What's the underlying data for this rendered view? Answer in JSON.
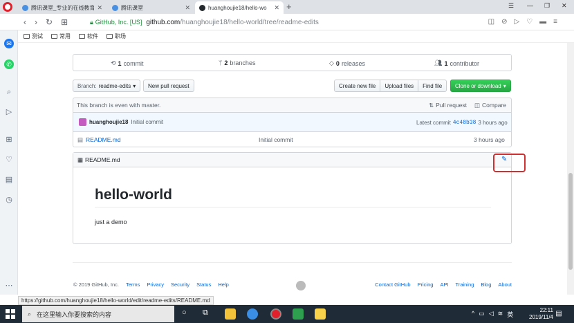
{
  "browser": {
    "tabs": [
      {
        "title": "腾讯课堂_专业的在线教育",
        "active": false
      },
      {
        "title": "腾讯课堂",
        "active": false
      },
      {
        "title": "huanghoujie18/hello-wo",
        "active": true
      }
    ],
    "new_tab": "+",
    "url_org": "GitHub, Inc. [US]",
    "url_host": "github.com",
    "url_path": "/huanghoujie18/hello-world/tree/readme-edits",
    "bookmarks": [
      "测试",
      "常用",
      "软件",
      "职场"
    ],
    "status_url": "https://github.com/huanghoujie18/hello-world/edit/readme-edits/README.md"
  },
  "repo": {
    "stats": {
      "commits": "1",
      "commits_label": "commit",
      "branches": "2",
      "branches_label": "branches",
      "releases": "0",
      "releases_label": "releases",
      "contributors": "1",
      "contributors_label": "contributor"
    },
    "branch_label": "Branch:",
    "branch": "readme-edits",
    "new_pr": "New pull request",
    "create_file": "Create new file",
    "upload": "Upload files",
    "find": "Find file",
    "clone": "Clone or download",
    "even": "This branch is even with master.",
    "pull_request": "Pull request",
    "compare": "Compare",
    "commit_author": "huanghoujie18",
    "commit_msg": "Initial commit",
    "latest_label": "Latest commit",
    "latest_sha": "4c48b38",
    "latest_time": "3 hours ago",
    "files": [
      {
        "name": "README.md",
        "msg": "Initial commit",
        "age": "3 hours ago"
      }
    ],
    "readme_title": "README.md",
    "readme_h1": "hello-world",
    "readme_p": "just a demo"
  },
  "footer": {
    "copyright": "© 2019 GitHub, Inc.",
    "left": [
      "Terms",
      "Privacy",
      "Security",
      "Status",
      "Help"
    ],
    "right": [
      "Contact GitHub",
      "Pricing",
      "API",
      "Training",
      "Blog",
      "About"
    ]
  },
  "taskbar": {
    "search": "在这里输入你要搜索的内容",
    "time": "22:11",
    "date": "2019/11/4",
    "ime": "英"
  }
}
